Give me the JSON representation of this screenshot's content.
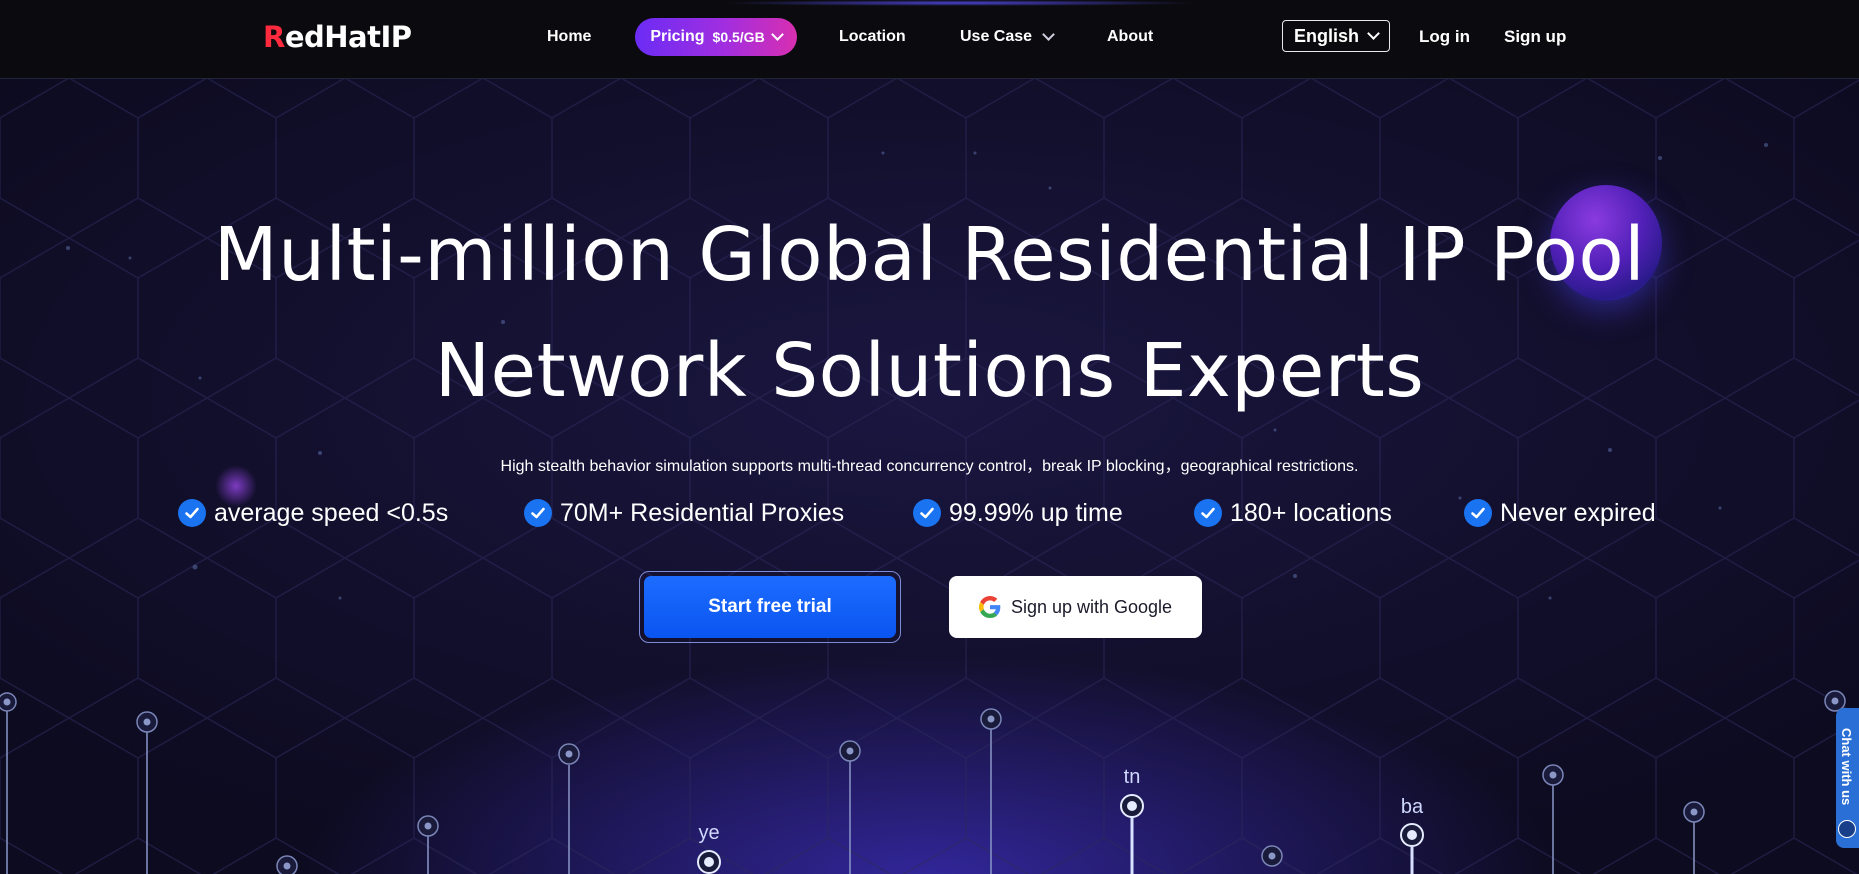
{
  "header": {
    "logo_prefix": "R",
    "logo_rest": "edHatIP",
    "nav": {
      "home": "Home",
      "pricing": "Pricing",
      "pricing_price": "$0.5/GB",
      "location": "Location",
      "use_case": "Use Case",
      "about": "About"
    },
    "language": "English",
    "login": "Log in",
    "signup": "Sign up"
  },
  "hero": {
    "title_line1": "Multi-million Global Residential IP Pool",
    "title_line2": "Network Solutions Experts",
    "subtitle": "High stealth behavior simulation supports multi-thread concurrency control，break IP blocking，geographical restrictions.",
    "features": [
      "average speed <0.5s",
      "70M+ Residential Proxies",
      "99.99% up time",
      "180+ locations",
      "Never expired"
    ],
    "cta_trial": "Start free trial",
    "cta_google": "Sign up with Google"
  },
  "map_labels": [
    "ye",
    "tn",
    "ba"
  ],
  "chat": {
    "label": "Chat with us"
  },
  "colors": {
    "accent_blue": "#1a73f0",
    "pricing_gradient_start": "#6b2cf5",
    "pricing_gradient_end": "#d82fb0",
    "logo_red": "#ff2a3d"
  },
  "icons": [
    "check-icon",
    "google-icon",
    "chevron-down-icon",
    "chat-icon"
  ]
}
